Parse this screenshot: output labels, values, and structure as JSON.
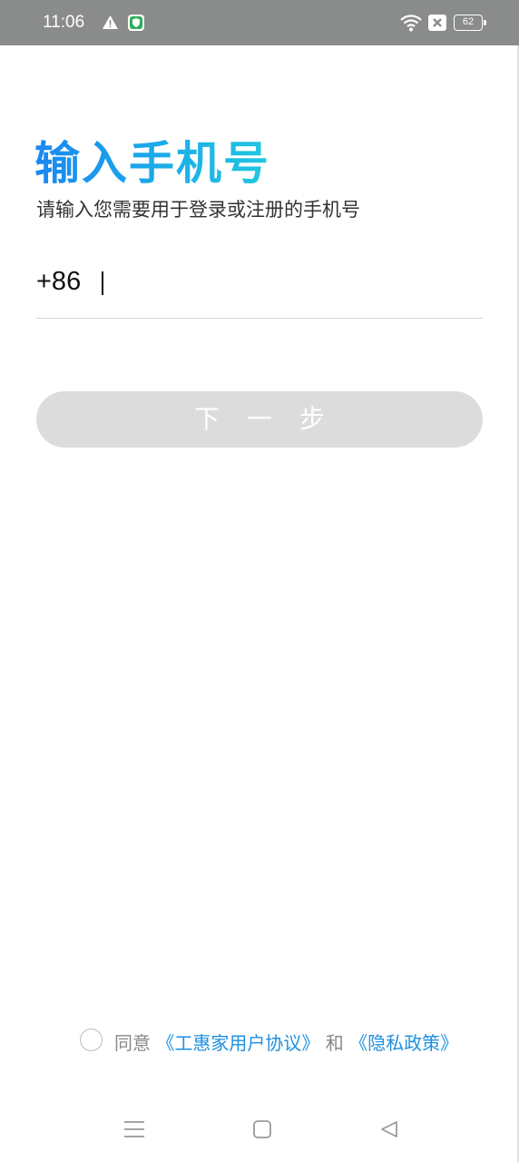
{
  "status_bar": {
    "time": "11:06",
    "battery_level": "62",
    "icons": [
      "warning-icon",
      "shield-icon",
      "wifi-icon",
      "sim-icon",
      "battery-icon"
    ]
  },
  "header": {
    "title": "输入手机号",
    "subtitle": "请输入您需要用于登录或注册的手机号"
  },
  "phone": {
    "country_code": "+86",
    "value": "",
    "placeholder": ""
  },
  "next_button": {
    "label": "下一步",
    "enabled": false
  },
  "agreement": {
    "prefix": "同意",
    "user_agreement": "《工惠家用户协议》",
    "and": "和",
    "privacy_policy": "《隐私政策》",
    "checked": false
  },
  "nav_bar": {
    "icons": [
      "menu-icon",
      "home-icon",
      "back-icon"
    ]
  },
  "colors": {
    "status_bar_bg": "#8a8c8c",
    "title_gradient_start": "#1a88f0",
    "title_gradient_end": "#22c7e0",
    "link": "#1e90e0",
    "button_disabled_bg": "#dcdcdc"
  }
}
